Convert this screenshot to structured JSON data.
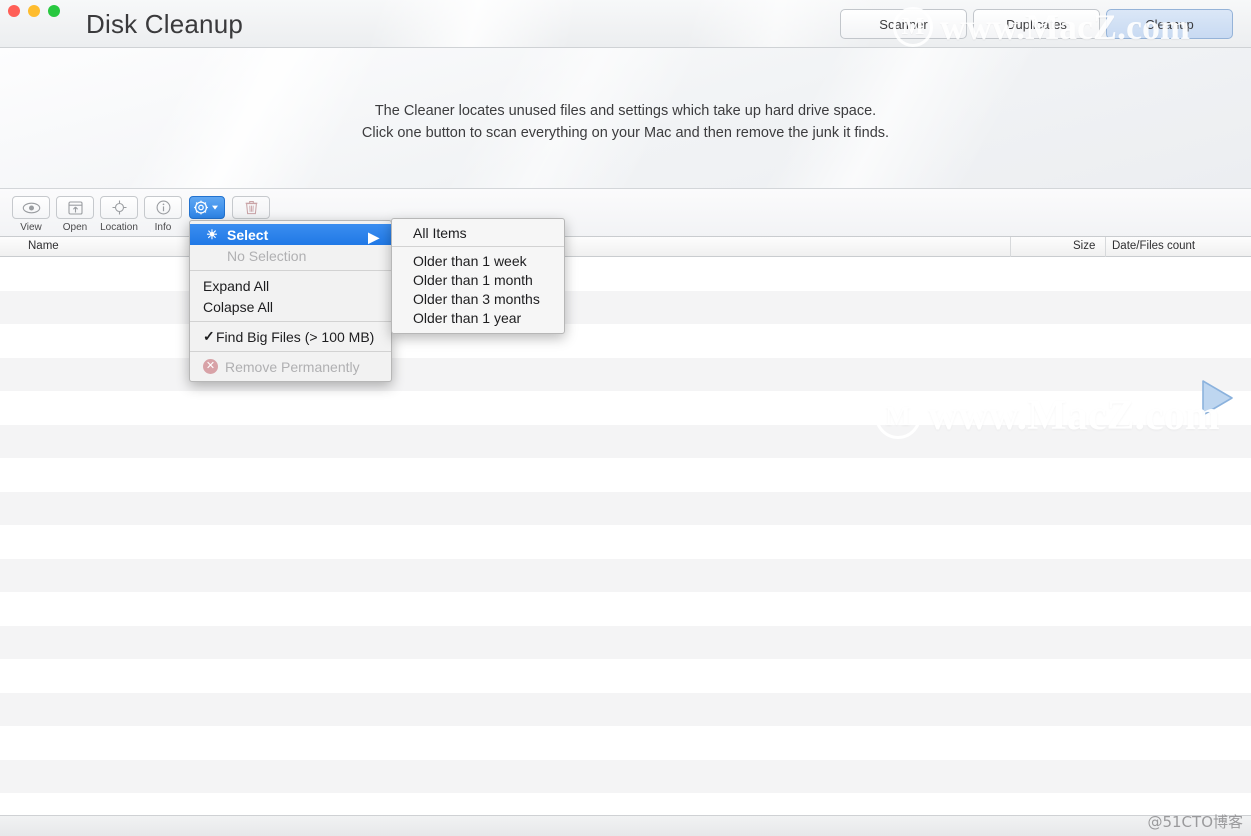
{
  "window": {
    "title": "Disk Cleanup",
    "traffic_lights": [
      {
        "name": "close",
        "color": "#ff5f57"
      },
      {
        "name": "minimize",
        "color": "#febc2e"
      },
      {
        "name": "zoom",
        "color": "#28c840"
      }
    ]
  },
  "segmented_buttons": [
    {
      "label": "Scanner",
      "active": false
    },
    {
      "label": "Duplicates",
      "active": false
    },
    {
      "label": "Cleanup",
      "active": true
    }
  ],
  "hero": {
    "line1": "The Cleaner locates unused files and settings which take up hard drive space.",
    "line2": "Click one button to scan everything on your Mac and then remove the junk it finds."
  },
  "toolbar": {
    "items": [
      {
        "label": "View",
        "icon": "eye-icon",
        "glyph": "◉",
        "state": "enabled"
      },
      {
        "label": "Open",
        "icon": "open-window-icon",
        "glyph": "⧉",
        "state": "enabled"
      },
      {
        "label": "Location",
        "icon": "crosshair-icon",
        "glyph": "⊕",
        "state": "enabled"
      },
      {
        "label": "Info",
        "icon": "info-icon",
        "glyph": "ⓘ",
        "state": "enabled"
      },
      {
        "label": "",
        "icon": "gear-dropdown-icon",
        "glyph": "⚙",
        "state": "active"
      },
      {
        "label": "",
        "icon": "trash-icon",
        "glyph": "🗑",
        "state": "disabled"
      }
    ],
    "play_button": {
      "name": "scan-play-button",
      "color": "#b9d3f0"
    }
  },
  "table": {
    "columns": [
      "Name",
      "Size",
      "Date/Files count"
    ],
    "rows": []
  },
  "menu": {
    "items": [
      {
        "label": "Select",
        "state": "highlighted",
        "submenu_arrow": "▶",
        "icon": "bulb-icon",
        "glyph": "☀"
      },
      {
        "label": "No Selection",
        "state": "disabled"
      },
      {
        "separator": true
      },
      {
        "label": "Expand All",
        "state": "enabled"
      },
      {
        "label": "Colapse All",
        "state": "enabled"
      },
      {
        "separator2": true
      },
      {
        "label": "Find Big Files (> 100 MB)",
        "state": "checked",
        "check": "✓"
      },
      {
        "separator3": true
      },
      {
        "label": "Remove Permanently",
        "state": "disabled",
        "icon": "remove-x-icon",
        "glyph": "✕"
      }
    ]
  },
  "submenu": {
    "items": [
      {
        "label": "All Items"
      },
      {
        "separator": true
      },
      {
        "label": "Older than 1 week"
      },
      {
        "label": "Older than 1 month"
      },
      {
        "label": "Older than 3 months"
      },
      {
        "label": "Older than 1 year"
      }
    ]
  },
  "watermarks": {
    "site": "www.MacZ.com",
    "logo_letter": "M",
    "corner": "@51CTO博客"
  },
  "colors": {
    "accent_blue": "#2079e6",
    "selected_tab": "#c8daf2",
    "play_blue": "#b9d3f0"
  }
}
